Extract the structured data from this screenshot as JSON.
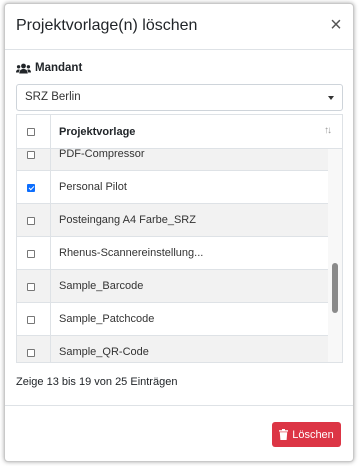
{
  "dialog": {
    "title": "Projektvorlage(n) löschen",
    "close_glyph": "×",
    "close_icon": "close-icon"
  },
  "mandant": {
    "label": "Mandant",
    "icon": "users-icon",
    "selected": "SRZ Berlin"
  },
  "table": {
    "header": "Projektvorlage",
    "header_checked": false,
    "sort_glyph": "↑↓",
    "rows": [
      {
        "label": "PDF-Compressor",
        "checked": false
      },
      {
        "label": "Personal Pilot",
        "checked": true
      },
      {
        "label": "Posteingang A4 Farbe_SRZ",
        "checked": false
      },
      {
        "label": "Rhenus-Scannereinstellung...",
        "checked": false
      },
      {
        "label": "Sample_Barcode",
        "checked": false
      },
      {
        "label": "Sample_Patchcode",
        "checked": false
      },
      {
        "label": "Sample_QR-Code",
        "checked": false
      }
    ],
    "scroll_position": 0.7
  },
  "info": "Zeige 13 bis 19 von 25 Einträgen",
  "footer": {
    "delete_label": "Löschen",
    "delete_icon": "trash-icon",
    "delete_color": "#dc3545"
  },
  "colors": {
    "accent": "#0d6efd",
    "danger": "#dc3545"
  }
}
